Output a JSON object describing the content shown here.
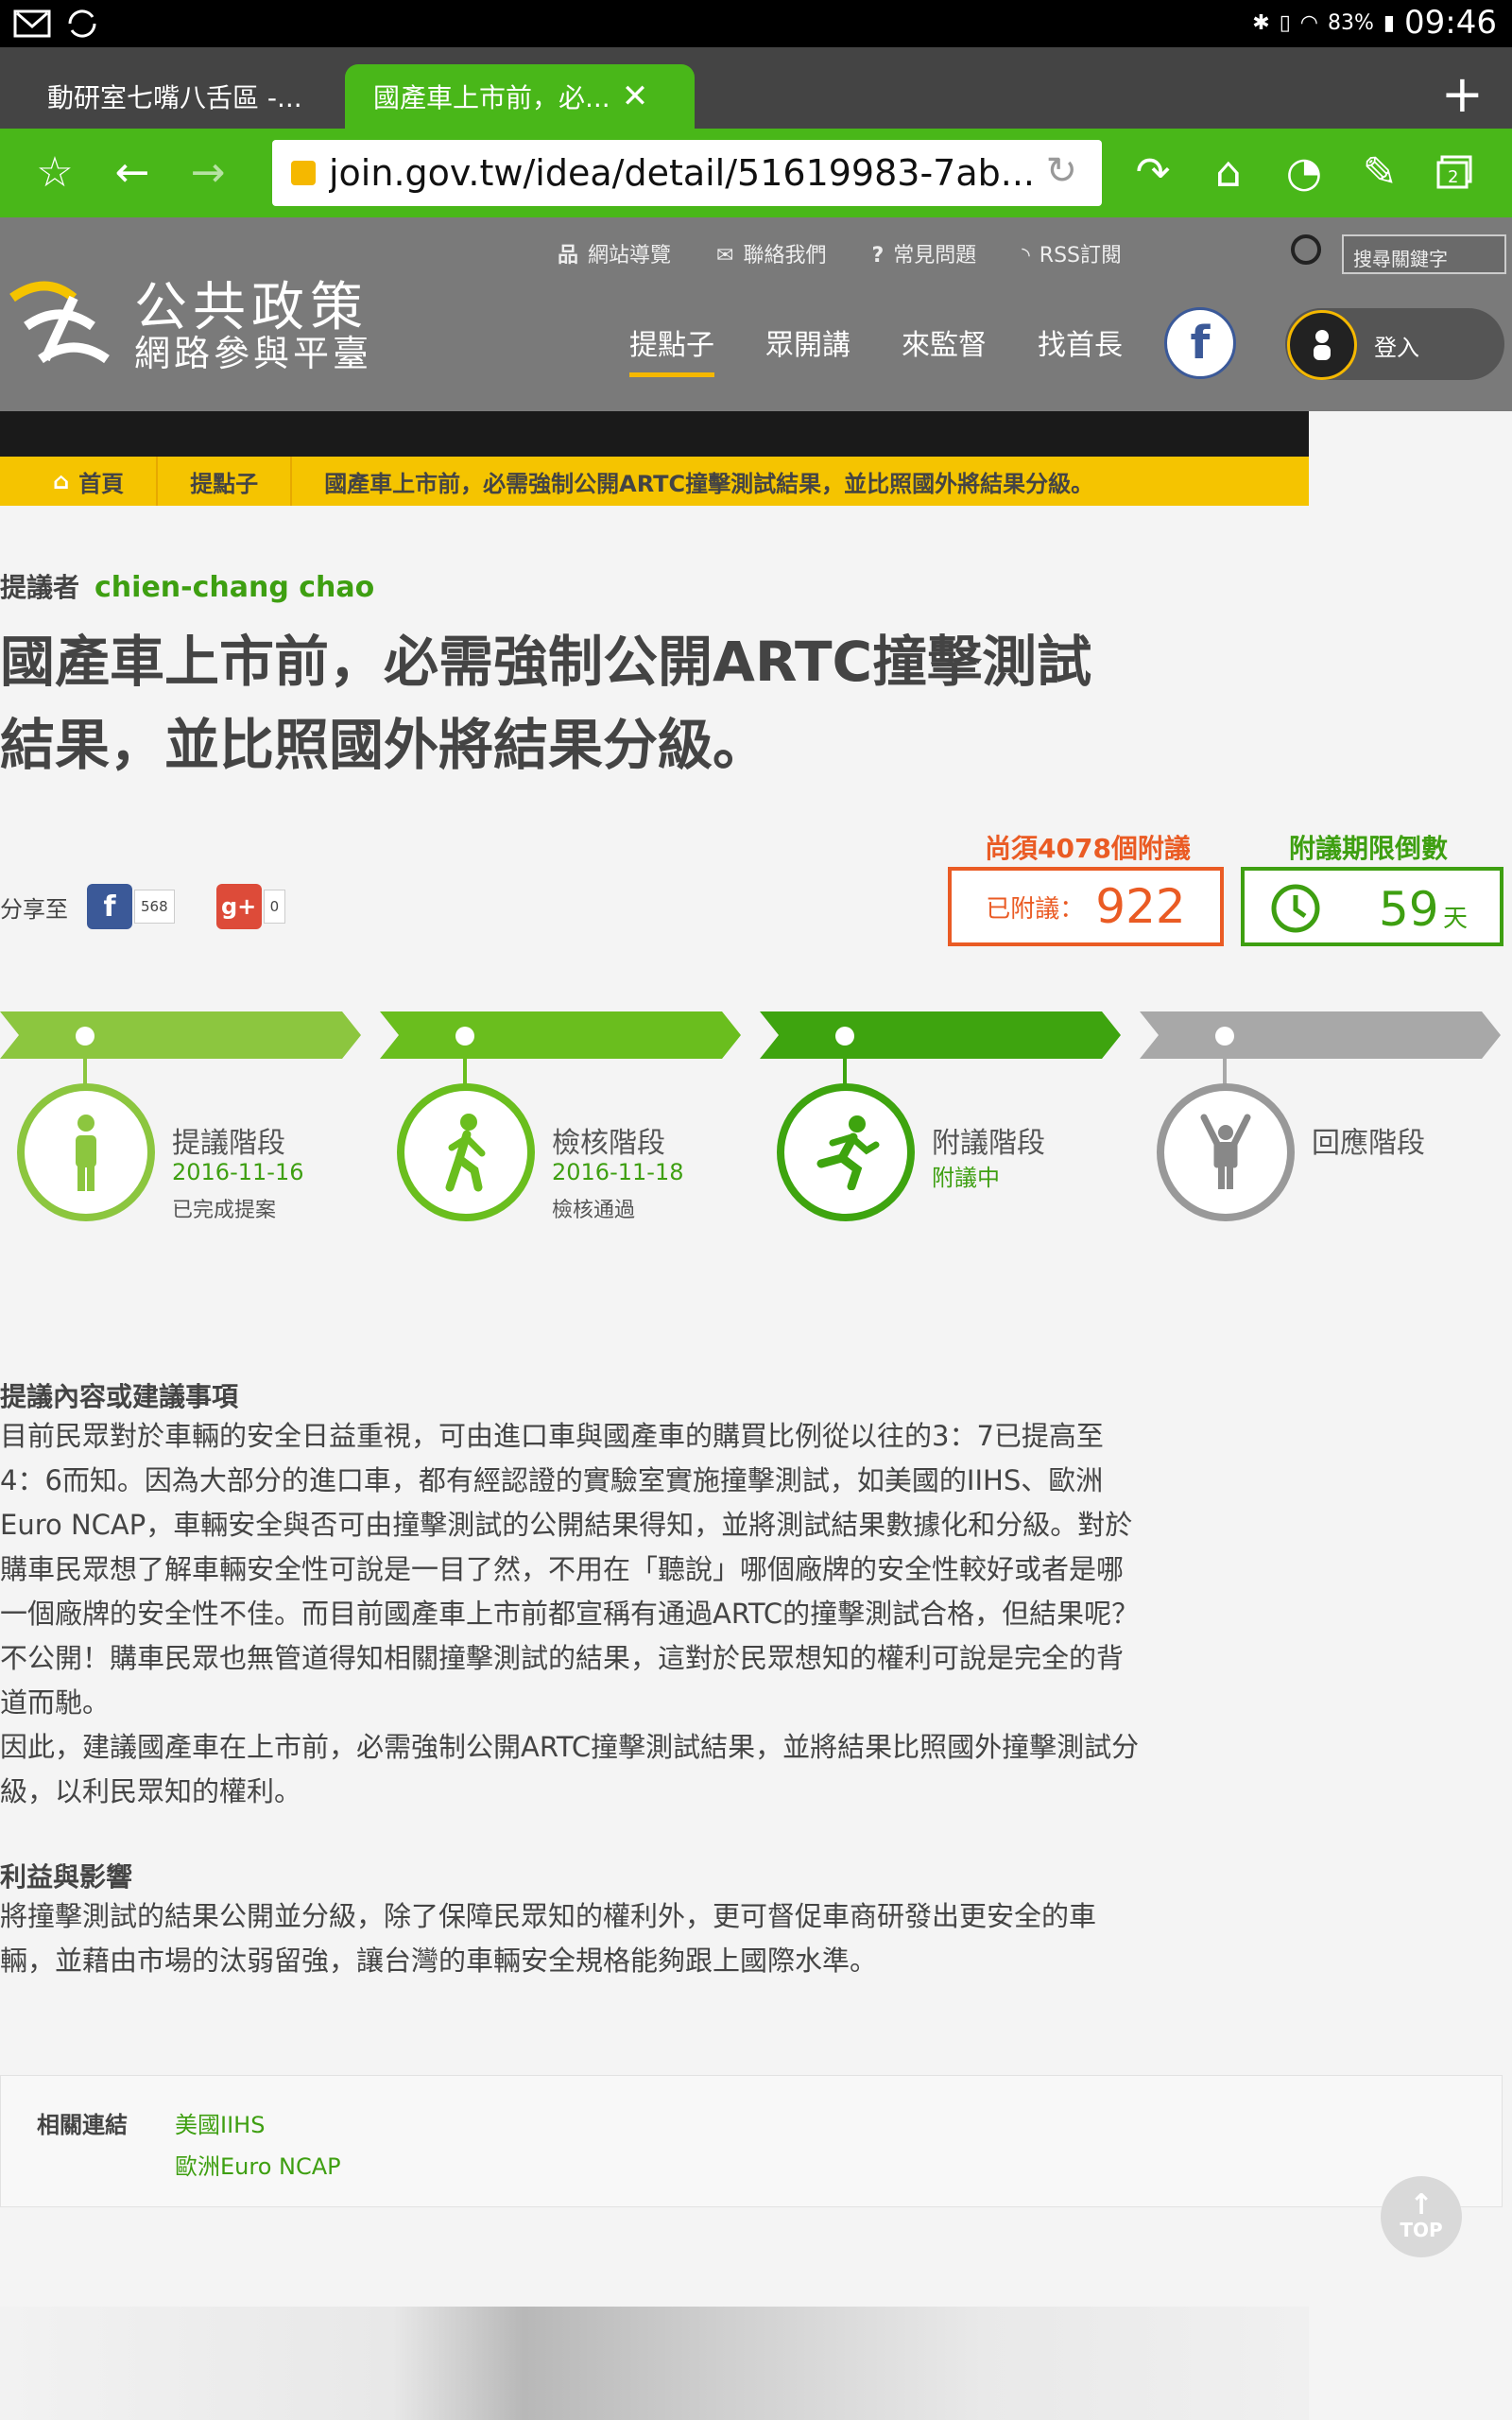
{
  "status": {
    "battery": "83%",
    "time": "09:46"
  },
  "browser": {
    "tabs": [
      {
        "label": "動研室七嘴八舌區 -..."
      },
      {
        "label": "國產車上市前，必..."
      }
    ],
    "url": "join.gov.tw/idea/detail/51619983-7ab..."
  },
  "site": {
    "logo_line1": "公共政策",
    "logo_line2": "網路參與平臺",
    "top_links": [
      "網站導覽",
      "聯絡我們",
      "常見問題",
      "RSS訂閱"
    ],
    "search_placeholder": "搜尋關鍵字",
    "main_nav": [
      "提點子",
      "眾開講",
      "來監督",
      "找首長"
    ],
    "login": "登入"
  },
  "breadcrumb": [
    "首頁",
    "提點子",
    "國產車上市前，必需強制公開ARTC撞擊測試結果，並比照國外將結果分級。"
  ],
  "proposal": {
    "proposer_label": "提議者",
    "proposer": "chien-chang chao",
    "title": "國產車上市前，必需強制公開ARTC撞擊測試結果，並比照國外將結果分級。"
  },
  "share": {
    "label": "分享至",
    "facebook_count": "568",
    "gplus_count": "0"
  },
  "stats": {
    "need_label": "尚須4078個附議",
    "count_label": "已附議：",
    "count": "922",
    "days_label": "附議期限倒數",
    "days": "59",
    "days_unit": "天"
  },
  "stages": [
    {
      "name": "提議階段",
      "date": "2016-11-16",
      "status": "已完成提案"
    },
    {
      "name": "檢核階段",
      "date": "2016-11-18",
      "status": "檢核通過"
    },
    {
      "name": "附議階段",
      "date": "附議中",
      "status": ""
    },
    {
      "name": "回應階段",
      "date": "",
      "status": ""
    }
  ],
  "sections": {
    "content_heading": "提議內容或建議事項",
    "content_p1": "目前民眾對於車輛的安全日益重視，可由進口車與國產車的購買比例從以往的3：7已提高至4：6而知。因為大部分的進口車，都有經認證的實驗室實施撞擊測試，如美國的IIHS、歐洲 Euro NCAP，車輛安全與否可由撞擊測試的公開結果得知，並將測試結果數據化和分級。對於購車民眾想了解車輛安全性可說是一目了然，不用在「聽說」哪個廠牌的安全性較好或者是哪一個廠牌的安全性不佳。而目前國產車上市前都宣稱有通過ARTC的撞擊測試合格，但結果呢？不公開！購車民眾也無管道得知相關撞擊測試的結果，這對於民眾想知的權利可說是完全的背道而馳。",
    "content_p2": "因此，建議國產車在上市前，必需強制公開ARTC撞擊測試結果，並將結果比照國外撞擊測試分級，以利民眾知的權利。",
    "benefit_heading": "利益與影響",
    "benefit_p": "將撞擊測試的結果公開並分級，除了保障民眾知的權利外，更可督促車商研發出更安全的車輛，並藉由市場的汰弱留強，讓台灣的車輛安全規格能夠跟上國際水準。"
  },
  "links": {
    "heading": "相關連結",
    "items": [
      "美國IIHS",
      "歐洲Euro NCAP"
    ]
  },
  "top_button": "TOP",
  "colors": {
    "brand_green": "#49b719",
    "accent_yellow": "#f5c400",
    "orange": "#ea5b24",
    "inactive_gray": "#999999"
  }
}
